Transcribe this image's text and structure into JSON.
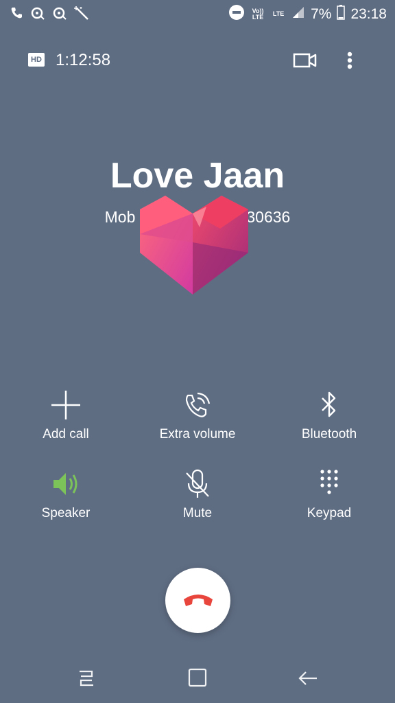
{
  "status_bar": {
    "battery": "7%",
    "time": "23:18",
    "network_1": "Vo)) LTE",
    "network_2": "LTE"
  },
  "call": {
    "hd_badge": "HD",
    "duration": "1:12:58",
    "contact_name": "Love Jaan",
    "number_prefix": "Mob",
    "number_suffix": "30636"
  },
  "controls": [
    {
      "label": "Add call",
      "icon": "plus-icon"
    },
    {
      "label": "Extra volume",
      "icon": "phone-volume-icon"
    },
    {
      "label": "Bluetooth",
      "icon": "bluetooth-icon"
    },
    {
      "label": "Speaker",
      "icon": "speaker-icon",
      "active_color": "#7cc35a"
    },
    {
      "label": "Mute",
      "icon": "mic-off-icon"
    },
    {
      "label": "Keypad",
      "icon": "keypad-icon"
    }
  ],
  "colors": {
    "background": "#5f6d83",
    "end_call": "#e8453c",
    "speaker_active": "#7cc35a"
  }
}
